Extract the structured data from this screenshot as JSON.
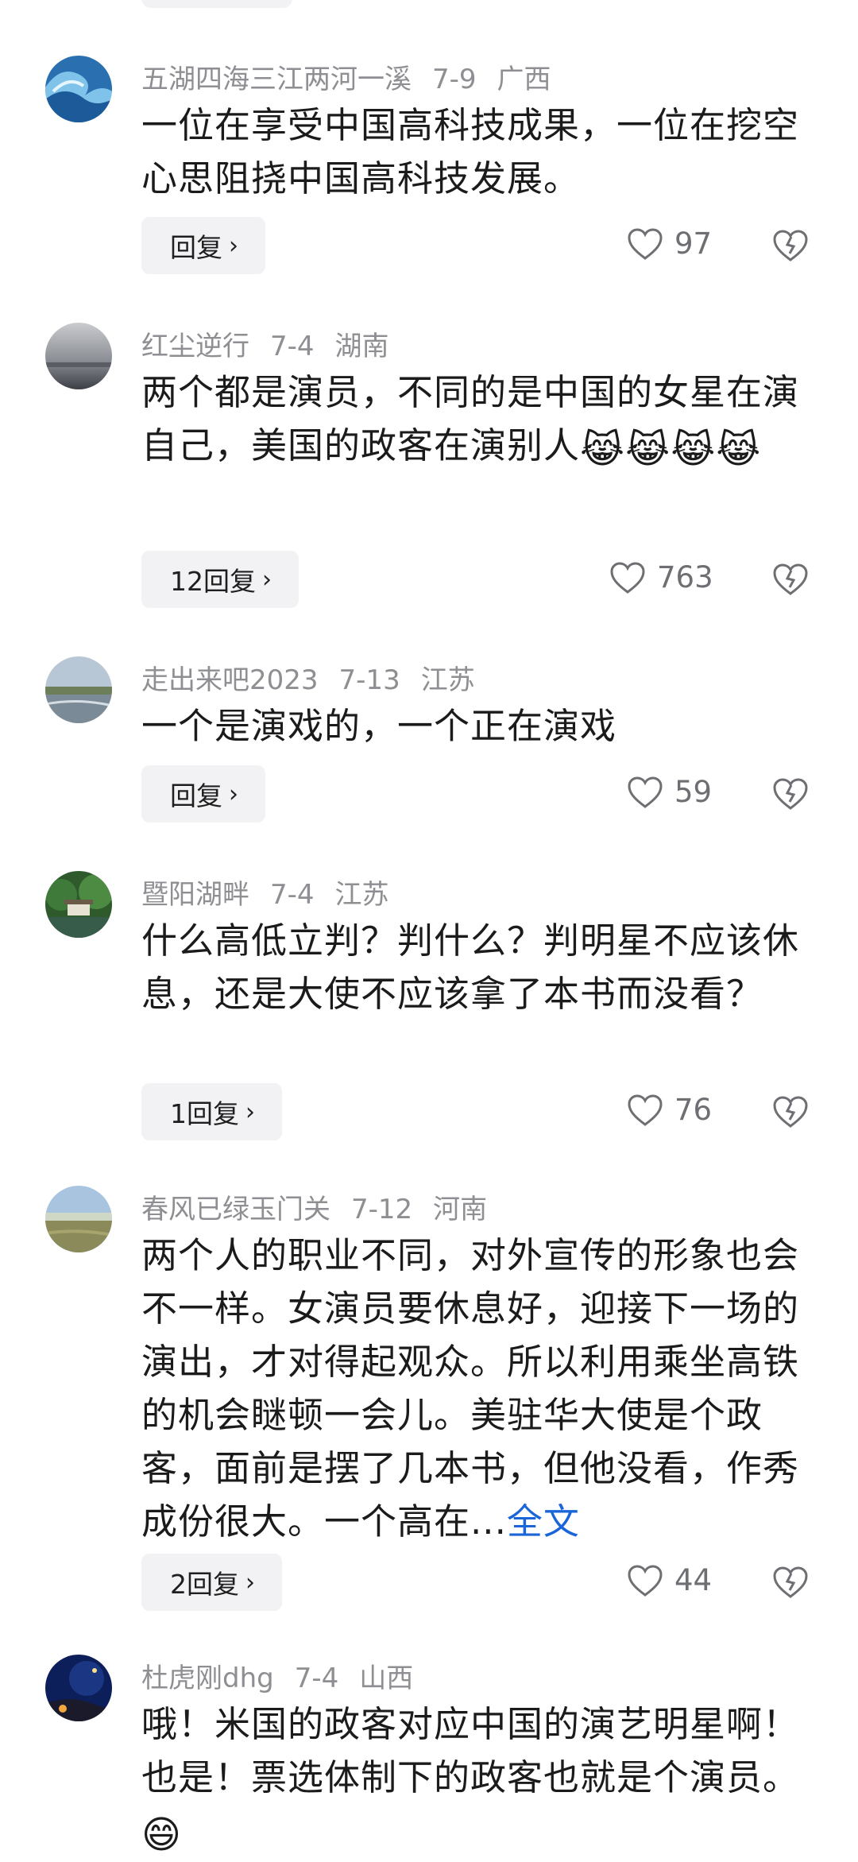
{
  "comments": [
    {
      "user": "五湖四海三江两河一溪",
      "date": "7-9",
      "location": "广西",
      "text": "一位在享受中国高科技成果，一位在挖空心思阻挠中国高科技发展。",
      "reply_label": "回复",
      "likes": "97",
      "avatar": "wave-avatar"
    },
    {
      "user": "红尘逆行",
      "date": "7-4",
      "location": "湖南",
      "text": "两个都是演员，不同的是中国的女星在演自己，美国的政客在演别人",
      "emoji": "😹😹😹😹",
      "reply_label": "12回复",
      "likes": "763",
      "avatar": "fog-avatar"
    },
    {
      "user": "走出来吧2023",
      "date": "7-13",
      "location": "江苏",
      "text": "一个是演戏的，一个正在演戏",
      "reply_label": "回复",
      "likes": "59",
      "avatar": "lake-avatar"
    },
    {
      "user": "暨阳湖畔",
      "date": "7-4",
      "location": "江苏",
      "text": "什么高低立判？判什么？判明星不应该休息，还是大使不应该拿了本书而没看？",
      "reply_label": "1回复",
      "likes": "76",
      "avatar": "garden-avatar"
    },
    {
      "user": "春风已绿玉门关",
      "date": "7-12",
      "location": "河南",
      "text": "两个人的职业不同，对外宣传的形象也会不一样。女演员要休息好，迎接下一场的演出，才对得起观众。所以利用乘坐高铁的机会瞇顿一会儿。美驻华大使是个政客，面前是摆了几本书，但他没看，作秀成份很大。一个高在...",
      "full_link": "全文",
      "reply_label": "2回复",
      "likes": "44",
      "avatar": "grassland-avatar"
    },
    {
      "user": "杜虎刚dhg",
      "date": "7-4",
      "location": "山西",
      "text": "哦！米国的政客对应中国的演艺明星啊！也是！票选体制下的政客也就是个演员。",
      "emoji": "😄",
      "avatar": "night-avatar"
    }
  ],
  "colors": {
    "meta": "#8e8e93",
    "link": "#1a66d8",
    "button_bg": "#f2f2f4"
  }
}
